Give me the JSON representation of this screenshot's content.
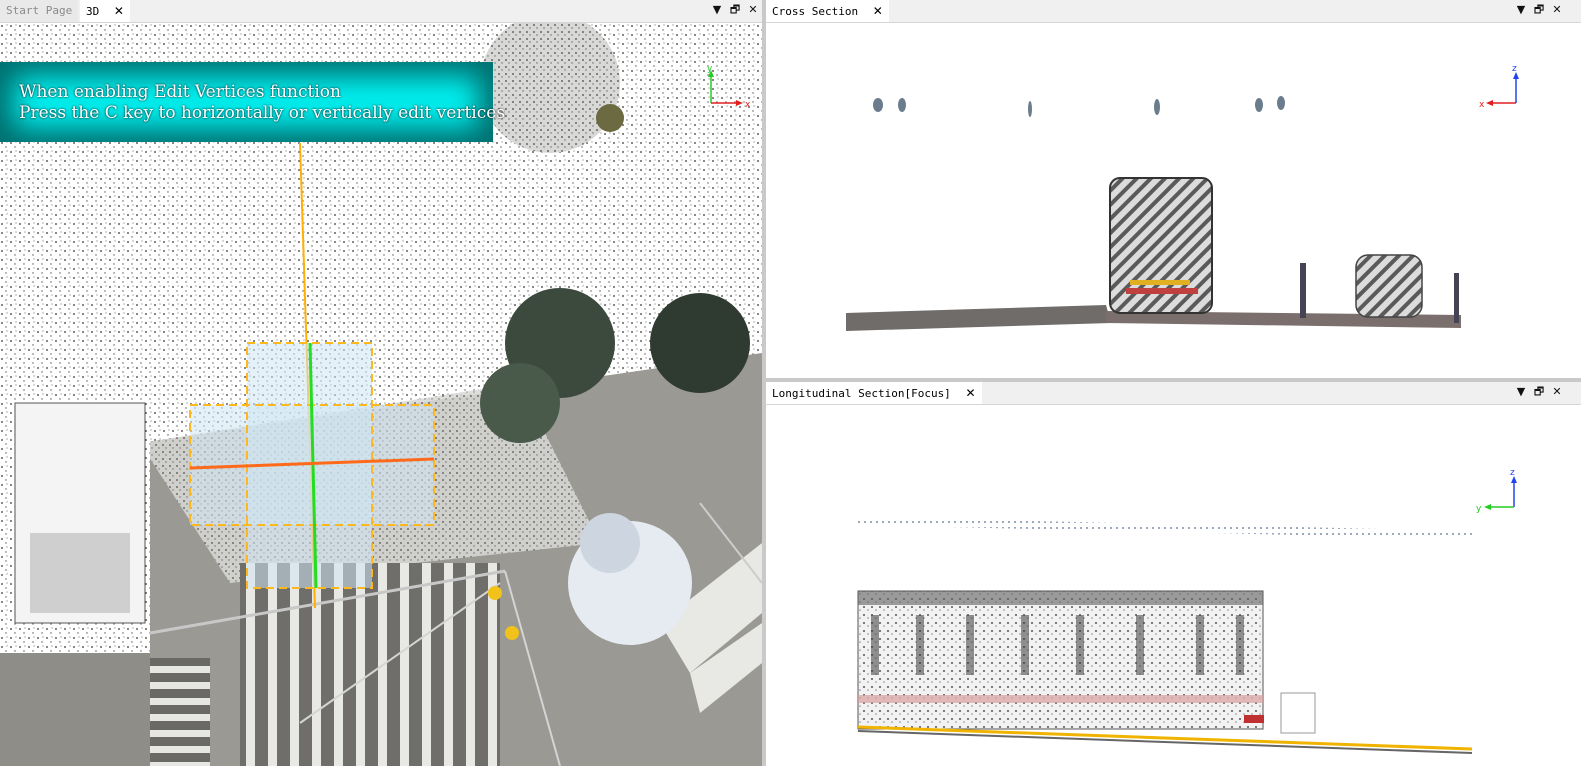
{
  "left_panel": {
    "tabs": [
      {
        "label": "Start Page",
        "active": false,
        "closable": false
      },
      {
        "label": "3D",
        "active": true,
        "closable": true
      }
    ],
    "controls": {
      "dropdown": "▼",
      "restore": "🗗",
      "close": "✕"
    },
    "callout": {
      "line1": "When enabling Edit Vertices function",
      "line2": "Press the C key to horizontally or vertically edit vertices"
    },
    "axis": {
      "y": "y",
      "x": "x"
    }
  },
  "cross_section": {
    "tab_label": "Cross Section",
    "close_glyph": "✕",
    "controls": {
      "dropdown": "▼",
      "restore": "🗗",
      "close": "✕"
    },
    "axis": {
      "z": "z",
      "x": "x"
    }
  },
  "longitudinal_section": {
    "tab_label": "Longitudinal Section[Focus]",
    "close_glyph": "✕",
    "controls": {
      "dropdown": "▼",
      "restore": "🗗",
      "close": "✕"
    },
    "axis": {
      "z": "z",
      "y": "y"
    }
  },
  "colors": {
    "callout_bg": "#00f0f0",
    "vertical_edit_line": "#22dd22",
    "horizontal_edit_line": "#ff6a1a",
    "selection_border": "#ffb81c",
    "axis_x": "#e02020",
    "axis_y": "#22cc22",
    "axis_z": "#2244ee"
  }
}
